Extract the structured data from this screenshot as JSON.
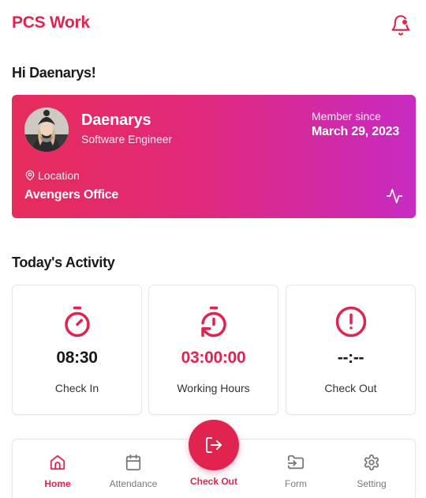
{
  "header": {
    "app_title": "PCS Work",
    "notification_icon": "bell-icon",
    "has_unread": true
  },
  "greeting": "Hi Daenarys!",
  "profile": {
    "name": "Daenarys",
    "role": "Software Engineer",
    "member_since_label": "Member since",
    "member_since_date": "March 29, 2023",
    "location_label": "Location",
    "location_value": "Avengers Office",
    "gradient_start": "#e62c5a",
    "gradient_end": "#c72bc2"
  },
  "activity": {
    "title": "Today's Activity",
    "cards": [
      {
        "value": "08:30",
        "label": "Check In",
        "icon": "stopwatch-icon",
        "value_color": "#1a1a1a"
      },
      {
        "value": "03:00:00",
        "label": "Working Hours",
        "icon": "timer-reset-icon",
        "value_color": "#e0244f"
      },
      {
        "value": "--:--",
        "label": "Check Out",
        "icon": "alert-circle-icon",
        "value_color": "#1a1a1a"
      }
    ]
  },
  "nav": {
    "items": [
      {
        "label": "Home",
        "icon": "home-icon",
        "active": true
      },
      {
        "label": "Attendance",
        "icon": "calendar-icon",
        "active": false
      },
      {
        "label": "Form",
        "icon": "folder-input-icon",
        "active": false
      },
      {
        "label": "Setting",
        "icon": "gear-icon",
        "active": false
      }
    ],
    "fab_label": "Check Out",
    "fab_icon": "logout-icon"
  },
  "colors": {
    "accent": "#e0244f",
    "muted": "#7a7a7a"
  }
}
